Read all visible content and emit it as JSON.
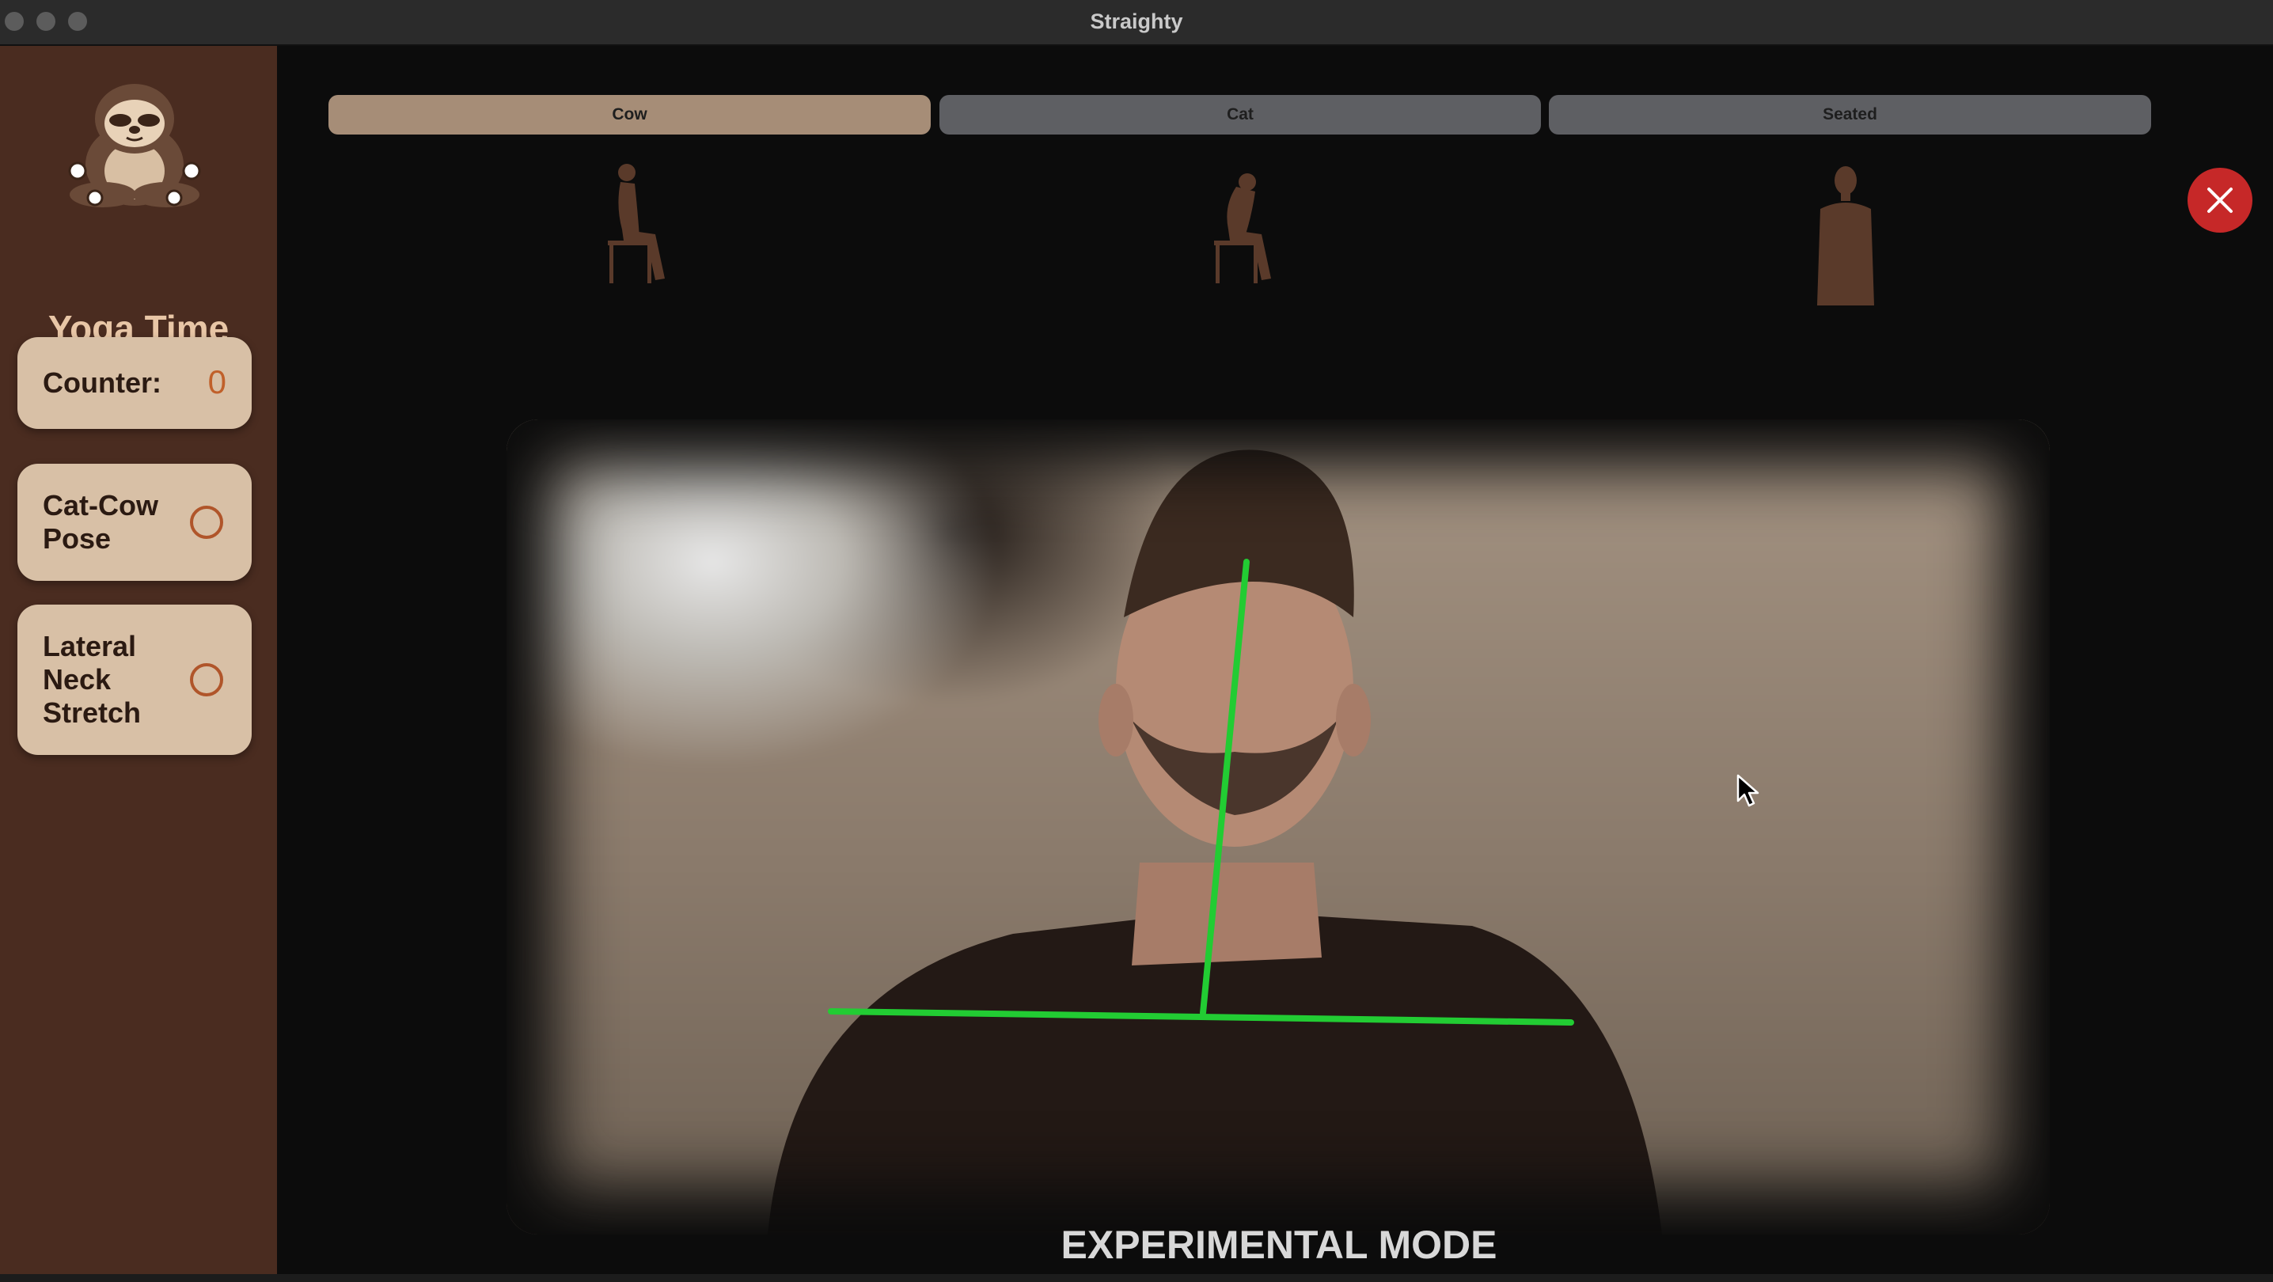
{
  "window": {
    "title": "Straighty"
  },
  "sidebar": {
    "app_name": "Yoga Time",
    "counter": {
      "label": "Counter:",
      "value": "0"
    },
    "exercises": [
      {
        "label_lines": [
          "Cat-Cow",
          "Pose"
        ],
        "done": false
      },
      {
        "label_lines": [
          "Lateral",
          "Neck",
          "Stretch"
        ],
        "done": false
      }
    ]
  },
  "tabs": [
    {
      "label": "Cow",
      "active": true
    },
    {
      "label": "Cat",
      "active": false
    },
    {
      "label": "Seated",
      "active": false
    }
  ],
  "pose_figures": [
    "cow-pose-figure",
    "cat-pose-figure",
    "seated-pose-figure"
  ],
  "camera": {
    "overlay_color": "#22cc33",
    "mode_label": "EXPERIMENTAL MODE"
  },
  "colors": {
    "sidebar": "#4a2c20",
    "card": "#d8c0a6",
    "accent": "#c0602a",
    "tab_active": "#a68d77",
    "tab_inactive": "#5e5f63",
    "close_button": "#c62828"
  }
}
